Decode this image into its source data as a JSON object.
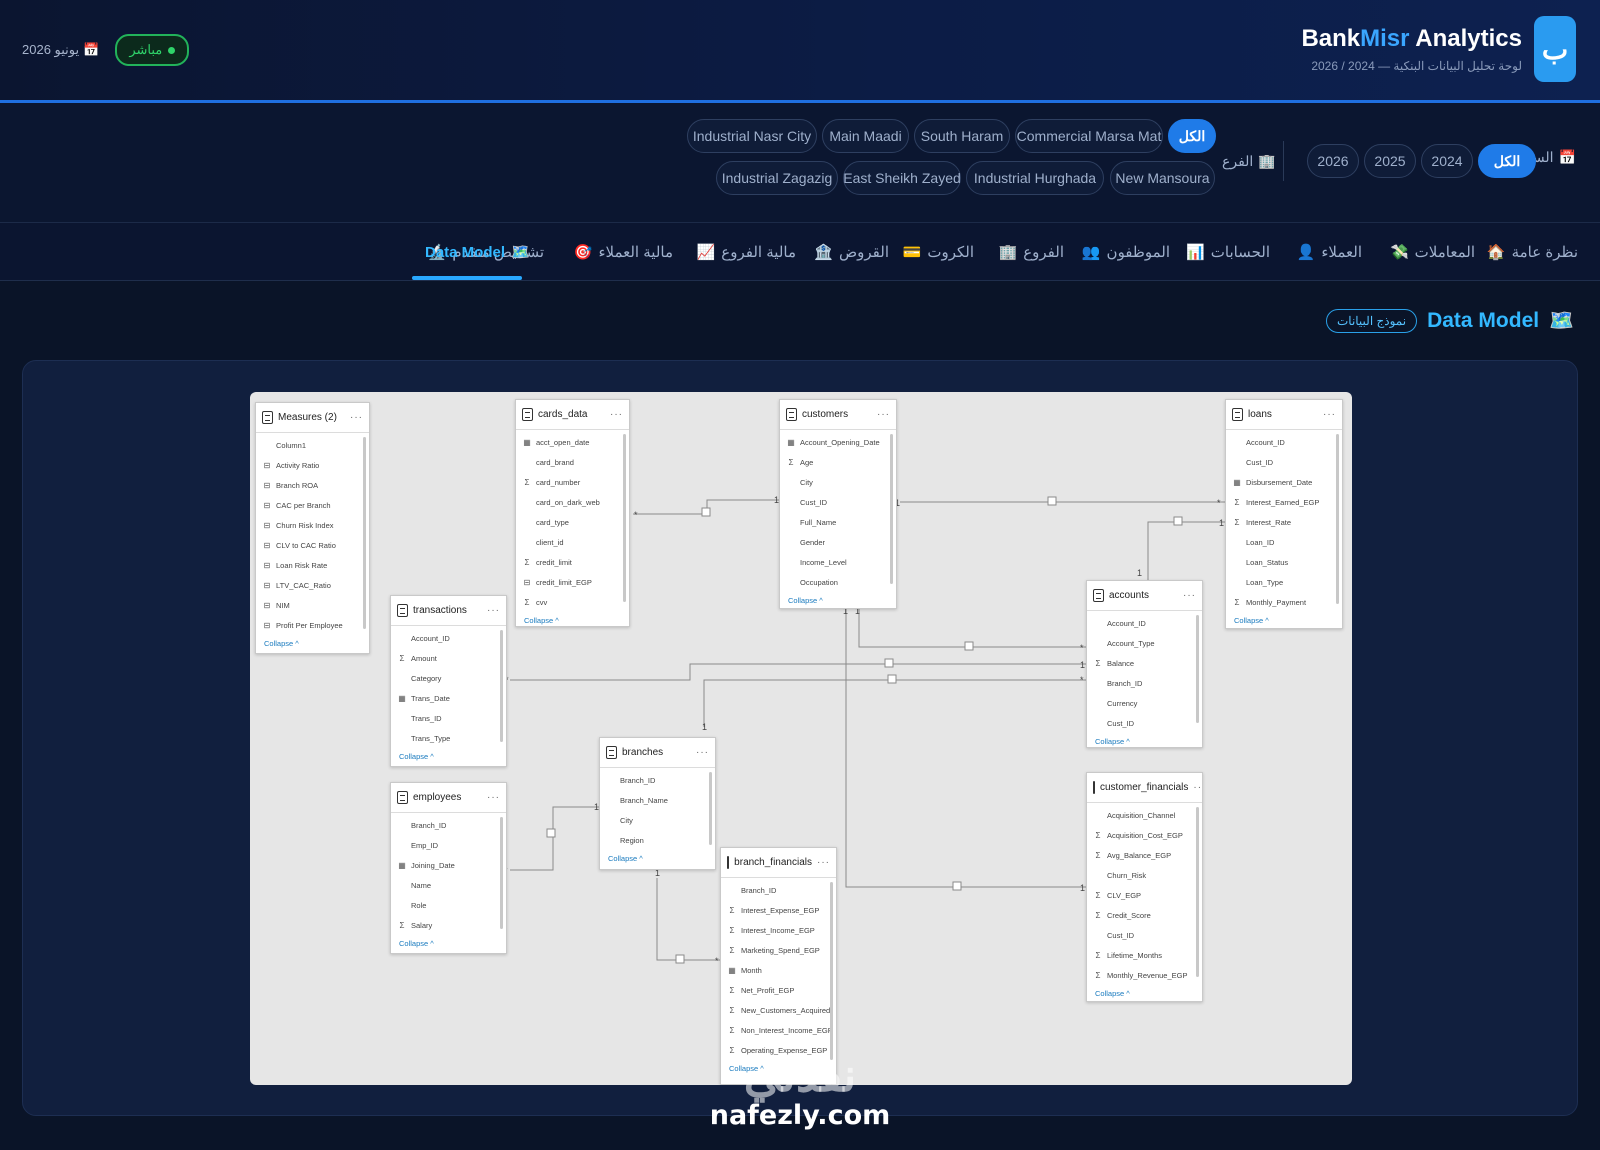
{
  "header": {
    "logo_letter": "ب",
    "brand_bank": "Bank",
    "brand_misr": "Misr",
    "brand_analytics": " Analytics",
    "subtitle": "لوحة تحليل البيانات البنكية — 2024 / 2026",
    "live_label": "مباشر",
    "date_label": "يونيو 2026",
    "date_icon": "calendar-icon"
  },
  "filters": {
    "year_label": "السنة",
    "year_icon": "calendar-icon",
    "years": [
      "الكل",
      "2024",
      "2025",
      "2026"
    ],
    "branch_label": "الفرع",
    "branch_icon": "building-icon",
    "branches_row1": [
      "الكل",
      "Commercial Marsa Mat",
      "South Haram",
      "Main Maadi",
      "Industrial Nasr City"
    ],
    "branches_row2": [
      "New Mansoura",
      "Industrial Hurghada",
      "East Sheikh Zayed",
      "Industrial Zagazig"
    ]
  },
  "tabs": [
    {
      "label": "نظرة عامة",
      "icon": "house-icon"
    },
    {
      "label": "المعاملات",
      "icon": "money-icon"
    },
    {
      "label": "العملاء",
      "icon": "user-icon"
    },
    {
      "label": "الحسابات",
      "icon": "bar-chart-icon"
    },
    {
      "label": "الموظفون",
      "icon": "users-icon"
    },
    {
      "label": "الفروع",
      "icon": "building-icon"
    },
    {
      "label": "الكروت",
      "icon": "card-icon"
    },
    {
      "label": "القروض",
      "icon": "bank-icon"
    },
    {
      "label": "مالية الفروع",
      "icon": "trend-icon"
    },
    {
      "label": "مالية العملاء",
      "icon": "target-icon"
    },
    {
      "label": "تشخيص متقدم",
      "icon": "microscope-icon"
    },
    {
      "label": "Data Model",
      "icon": "map-icon"
    }
  ],
  "section": {
    "title": "Data Model",
    "badge": "نموذج البيانات",
    "icon": "map-icon"
  },
  "model": {
    "collapse_label": "Collapse ^",
    "tables": {
      "measures": {
        "name": "Measures (2)",
        "fields": [
          {
            "n": "Column1",
            "s": ""
          },
          {
            "n": "Activity Ratio",
            "s": "m"
          },
          {
            "n": "Branch ROA",
            "s": "m"
          },
          {
            "n": "CAC per Branch",
            "s": "m"
          },
          {
            "n": "Churn Risk Index",
            "s": "m"
          },
          {
            "n": "CLV to CAC Ratio",
            "s": "m"
          },
          {
            "n": "Loan Risk Rate",
            "s": "m"
          },
          {
            "n": "LTV_CAC_Ratio",
            "s": "m"
          },
          {
            "n": "NIM",
            "s": "m"
          },
          {
            "n": "Profit Per Employee",
            "s": "m"
          }
        ]
      },
      "cards": {
        "name": "cards_data",
        "fields": [
          {
            "n": "acct_open_date",
            "s": "d"
          },
          {
            "n": "card_brand",
            "s": ""
          },
          {
            "n": "card_number",
            "s": "Σ"
          },
          {
            "n": "card_on_dark_web",
            "s": ""
          },
          {
            "n": "card_type",
            "s": ""
          },
          {
            "n": "client_id",
            "s": ""
          },
          {
            "n": "credit_limit",
            "s": "Σ"
          },
          {
            "n": "credit_limit_EGP",
            "s": "m"
          },
          {
            "n": "cvv",
            "s": "Σ"
          }
        ]
      },
      "customers": {
        "name": "customers",
        "fields": [
          {
            "n": "Account_Opening_Date",
            "s": "d"
          },
          {
            "n": "Age",
            "s": "Σ"
          },
          {
            "n": "City",
            "s": ""
          },
          {
            "n": "Cust_ID",
            "s": ""
          },
          {
            "n": "Full_Name",
            "s": ""
          },
          {
            "n": "Gender",
            "s": ""
          },
          {
            "n": "Income_Level",
            "s": ""
          },
          {
            "n": "Occupation",
            "s": ""
          }
        ]
      },
      "loans": {
        "name": "loans",
        "fields": [
          {
            "n": "Account_ID",
            "s": ""
          },
          {
            "n": "Cust_ID",
            "s": ""
          },
          {
            "n": "Disbursement_Date",
            "s": "d"
          },
          {
            "n": "Interest_Earned_EGP",
            "s": "Σ"
          },
          {
            "n": "Interest_Rate",
            "s": "Σ"
          },
          {
            "n": "Loan_ID",
            "s": ""
          },
          {
            "n": "Loan_Status",
            "s": ""
          },
          {
            "n": "Loan_Type",
            "s": ""
          },
          {
            "n": "Monthly_Payment",
            "s": "Σ"
          }
        ]
      },
      "transactions": {
        "name": "transactions",
        "fields": [
          {
            "n": "Account_ID",
            "s": ""
          },
          {
            "n": "Amount",
            "s": "Σ"
          },
          {
            "n": "Category",
            "s": ""
          },
          {
            "n": "Trans_Date",
            "s": "d"
          },
          {
            "n": "Trans_ID",
            "s": ""
          },
          {
            "n": "Trans_Type",
            "s": ""
          }
        ]
      },
      "accounts": {
        "name": "accounts",
        "fields": [
          {
            "n": "Account_ID",
            "s": ""
          },
          {
            "n": "Account_Type",
            "s": ""
          },
          {
            "n": "Balance",
            "s": "Σ"
          },
          {
            "n": "Branch_ID",
            "s": ""
          },
          {
            "n": "Currency",
            "s": ""
          },
          {
            "n": "Cust_ID",
            "s": ""
          }
        ]
      },
      "branches": {
        "name": "branches",
        "fields": [
          {
            "n": "Branch_ID",
            "s": ""
          },
          {
            "n": "Branch_Name",
            "s": ""
          },
          {
            "n": "City",
            "s": ""
          },
          {
            "n": "Region",
            "s": ""
          }
        ]
      },
      "employees": {
        "name": "employees",
        "fields": [
          {
            "n": "Branch_ID",
            "s": ""
          },
          {
            "n": "Emp_ID",
            "s": ""
          },
          {
            "n": "Joining_Date",
            "s": "d"
          },
          {
            "n": "Name",
            "s": ""
          },
          {
            "n": "Role",
            "s": ""
          },
          {
            "n": "Salary",
            "s": "Σ"
          }
        ]
      },
      "branch_fin": {
        "name": "branch_financials",
        "fields": [
          {
            "n": "Branch_ID",
            "s": ""
          },
          {
            "n": "Interest_Expense_EGP",
            "s": "Σ"
          },
          {
            "n": "Interest_Income_EGP",
            "s": "Σ"
          },
          {
            "n": "Marketing_Spend_EGP",
            "s": "Σ"
          },
          {
            "n": "Month",
            "s": "d"
          },
          {
            "n": "Net_Profit_EGP",
            "s": "Σ"
          },
          {
            "n": "New_Customers_Acquired",
            "s": "Σ"
          },
          {
            "n": "Non_Interest_Income_EGP",
            "s": "Σ"
          },
          {
            "n": "Operating_Expense_EGP",
            "s": "Σ"
          }
        ]
      },
      "cust_fin": {
        "name": "customer_financials",
        "fields": [
          {
            "n": "Acquisition_Channel",
            "s": ""
          },
          {
            "n": "Acquisition_Cost_EGP",
            "s": "Σ"
          },
          {
            "n": "Avg_Balance_EGP",
            "s": "Σ"
          },
          {
            "n": "Churn_Risk",
            "s": ""
          },
          {
            "n": "CLV_EGP",
            "s": "Σ"
          },
          {
            "n": "Credit_Score",
            "s": "Σ"
          },
          {
            "n": "Cust_ID",
            "s": ""
          },
          {
            "n": "Lifetime_Months",
            "s": "Σ"
          },
          {
            "n": "Monthly_Revenue_EGP",
            "s": "Σ"
          }
        ]
      }
    }
  },
  "watermark": {
    "arabic": "نفذلي",
    "latin": "nafezly.com"
  },
  "colors": {
    "accent": "#1f7be8",
    "tab_active": "#33b8ff",
    "live": "#2fd36a",
    "canvas_bg": "#e6e6e6"
  }
}
